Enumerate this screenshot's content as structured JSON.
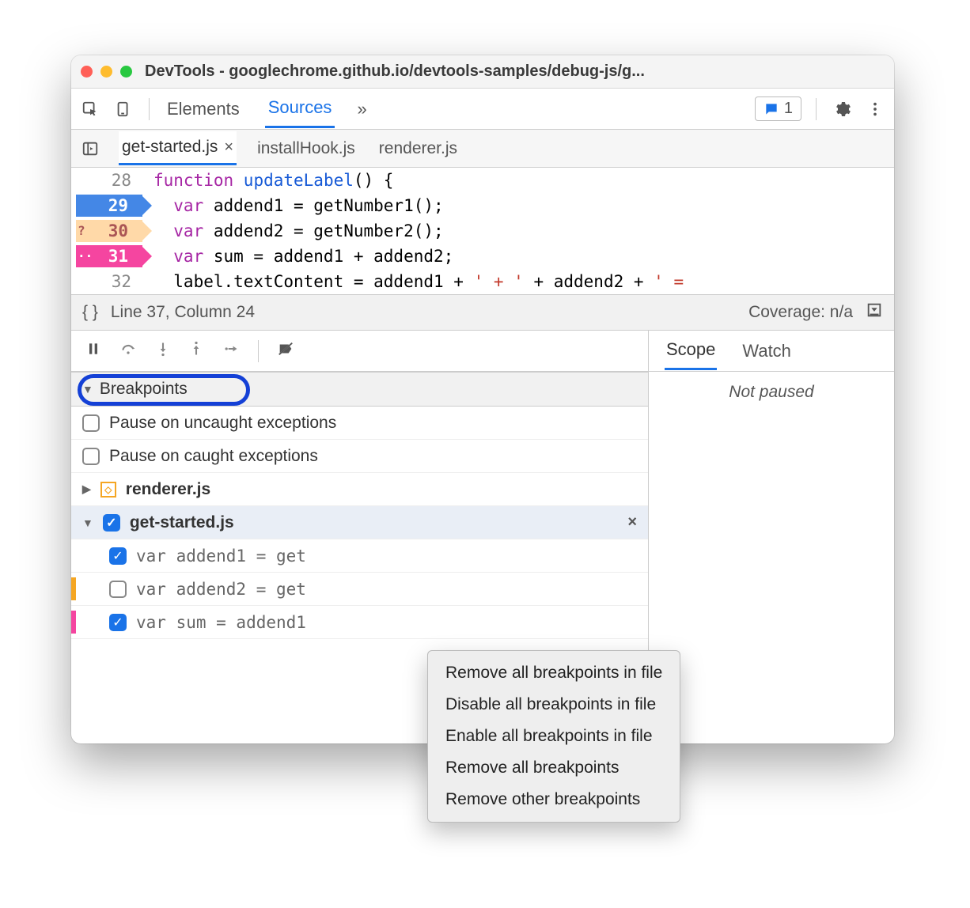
{
  "window": {
    "title": "DevTools - googlechrome.github.io/devtools-samples/debug-js/g..."
  },
  "toolbar": {
    "tabs": {
      "elements": "Elements",
      "sources": "Sources"
    },
    "issues_count": "1"
  },
  "filetabs": {
    "t0": "get-started.js",
    "t1": "installHook.js",
    "t2": "renderer.js"
  },
  "code": {
    "ln28": "28",
    "ln29": "29",
    "ln30": "30",
    "ln31": "31",
    "ln32": "32",
    "mark30": "?",
    "mark31": "··",
    "l28a": "function",
    "l28b": " updateLabel",
    "l28c": "() {",
    "l29a": "  var",
    "l29b": " addend1 = getNumber1();",
    "l30a": "  var",
    "l30b": " addend2 = getNumber2();",
    "l31a": "  var",
    "l31b": " sum = addend1 + addend2;",
    "l32a": "  label.textContent = addend1 + ",
    "l32b": "' + '",
    "l32c": " + addend2 + ",
    "l32d": "' ="
  },
  "status": {
    "braces": "{ }",
    "pos": "Line 37, Column 24",
    "coverage": "Coverage: n/a"
  },
  "breakpoints": {
    "section_label": "Breakpoints",
    "pause_uncaught": "Pause on uncaught exceptions",
    "pause_caught": "Pause on caught exceptions",
    "group0": "renderer.js",
    "group1": "get-started.js",
    "bp0": "var addend1 = get",
    "bp1": "var addend2 = get",
    "bp2": "var sum = addend1"
  },
  "right": {
    "scope": "Scope",
    "watch": "Watch",
    "not_paused": "Not paused"
  },
  "ctx": {
    "i0": "Remove all breakpoints in file",
    "i1": "Disable all breakpoints in file",
    "i2": "Enable all breakpoints in file",
    "i3": "Remove all breakpoints",
    "i4": "Remove other breakpoints"
  }
}
